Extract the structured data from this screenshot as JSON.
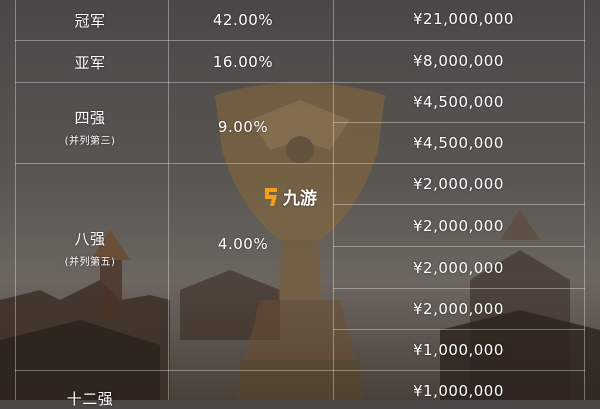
{
  "watermark": "九游",
  "rows": [
    {
      "rank": "冠军",
      "rank_sub": "",
      "percent": "42.00%",
      "prizes": [
        "¥21,000,000"
      ]
    },
    {
      "rank": "亚军",
      "rank_sub": "",
      "percent": "16.00%",
      "prizes": [
        "¥8,000,000"
      ]
    },
    {
      "rank": "四强",
      "rank_sub": "(并列第三)",
      "percent": "9.00%",
      "prizes": [
        "¥4,500,000",
        "¥4,500,000"
      ]
    },
    {
      "rank": "八强",
      "rank_sub": "(并列第五)",
      "percent": "4.00%",
      "prizes": [
        "¥2,000,000",
        "¥2,000,000",
        "¥2,000,000",
        "¥2,000,000"
      ]
    },
    {
      "rank": "十二强",
      "rank_sub": "",
      "percent": "",
      "prizes": [
        "¥1,000,000",
        "¥1,000,000"
      ]
    }
  ],
  "colors": {
    "text": "#ffffff",
    "trophy": "#8a6a3a",
    "watermark_accent": "#f2a019"
  }
}
